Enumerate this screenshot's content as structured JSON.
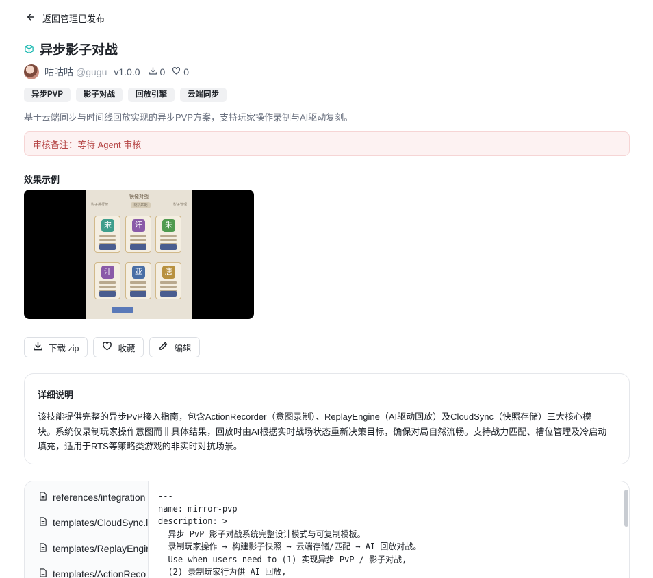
{
  "nav": {
    "back_label": "返回管理已发布"
  },
  "skill": {
    "title": "异步影子对战",
    "author": "咕咕咕",
    "handle": "@gugu",
    "version": "v1.0.0",
    "downloads": "0",
    "likes": "0",
    "tags": [
      "异步PVP",
      "影子对战",
      "回放引擎",
      "云端同步"
    ],
    "description": "基于云端同步与时间线回放实现的异步PVP方案，支持玩家操作录制与AI驱动复刻。",
    "review_note": "审核备注：等待 Agent 审核"
  },
  "preview": {
    "label": "效果示例",
    "screen_title": "— 镜像对战 —",
    "tabs": [
      "影子排行榜",
      "随机匹配",
      "影子管理"
    ],
    "seals": [
      {
        "char": "宋",
        "color": "#3f9e8c"
      },
      {
        "char": "汗",
        "color": "#8a5aa8"
      },
      {
        "char": "朱",
        "color": "#4f9a4f"
      },
      {
        "char": "汗",
        "color": "#8a5aa8"
      },
      {
        "char": "亚",
        "color": "#4a6fa5"
      },
      {
        "char": "唐",
        "color": "#b8913f"
      }
    ]
  },
  "actions": {
    "download": "下载 zip",
    "favorite": "收藏",
    "edit": "编辑"
  },
  "details": {
    "heading": "详细说明",
    "lines": [
      "该技能提供完整的异步PvP接入指南，包含ActionRecorder（意图录制）、ReplayEngine（AI驱动回放）及CloudSync（快照存储）三大核心模",
      "块。系统仅录制玩家操作意图而非具体结果，回放时由AI根据实时战场状态重新决策目标，确保对局自然流畅。支持战力匹配、槽位管理及冷启动",
      "填充，适用于RTS等策略类游戏的非实时对抗场景。"
    ]
  },
  "files": {
    "items": [
      "references/integration",
      "templates/CloudSync.l",
      "templates/ReplayEngir",
      "templates/ActionReco"
    ],
    "code_lines": [
      "---",
      "name: mirror-pvp",
      "description: >",
      "  异步 PvP 影子对战系统完整设计模式与可复制模板。",
      "  录制玩家操作 → 构建影子快照 → 云端存储/匹配 → AI 回放对战。",
      "  Use when users need to (1) 实现异步 PvP / 影子对战,",
      "  (2) 录制玩家行为供 AI 回放,"
    ]
  }
}
